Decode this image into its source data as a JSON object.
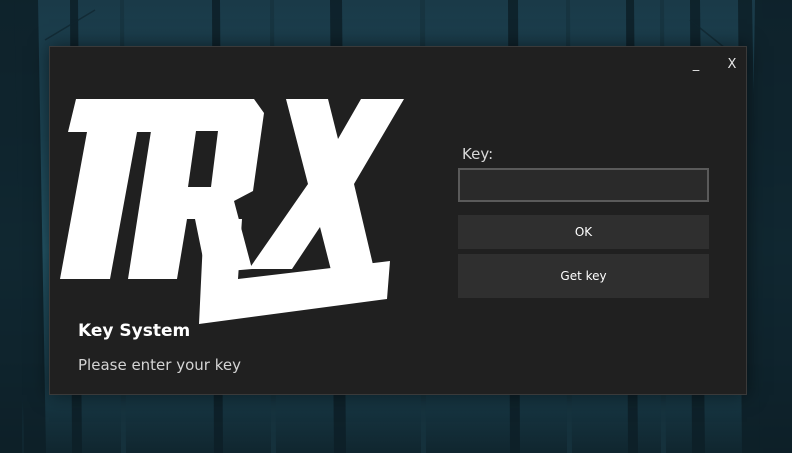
{
  "window": {
    "minimize_label": "_",
    "close_label": "X"
  },
  "logo": {
    "text": "TRX"
  },
  "app": {
    "title": "Key System",
    "subtitle": "Please enter your key"
  },
  "form": {
    "key_label": "Key:",
    "key_value": "",
    "ok_label": "OK",
    "get_key_label": "Get key"
  },
  "colors": {
    "window_bg": "#202020",
    "button_bg": "#2f2f2f",
    "input_border": "#5a5a5a",
    "text": "#ffffff"
  }
}
